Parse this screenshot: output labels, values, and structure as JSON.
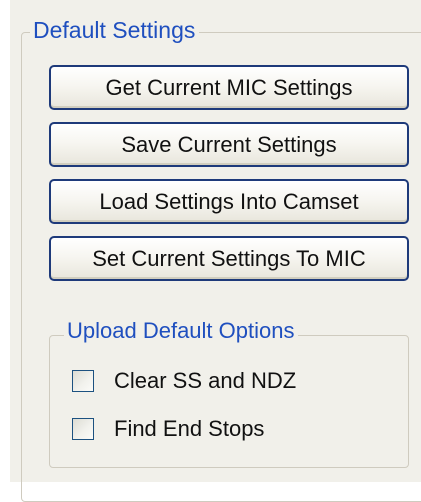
{
  "default_settings": {
    "title": "Default Settings",
    "buttons": {
      "get_current": "Get Current MIC Settings",
      "save_current": "Save Current Settings",
      "load_into_camset": "Load Settings Into Camset",
      "set_to_mic": "Set Current Settings To MIC"
    }
  },
  "upload_default_options": {
    "title": "Upload Default Options",
    "options": [
      {
        "label": "Clear SS and NDZ",
        "checked": false
      },
      {
        "label": "Find End Stops",
        "checked": false
      }
    ]
  },
  "colors": {
    "legend_text": "#1f4fbf",
    "button_border": "#1e3a7a",
    "panel_background": "#f1f0ea",
    "group_border": "#cfcbbf"
  }
}
